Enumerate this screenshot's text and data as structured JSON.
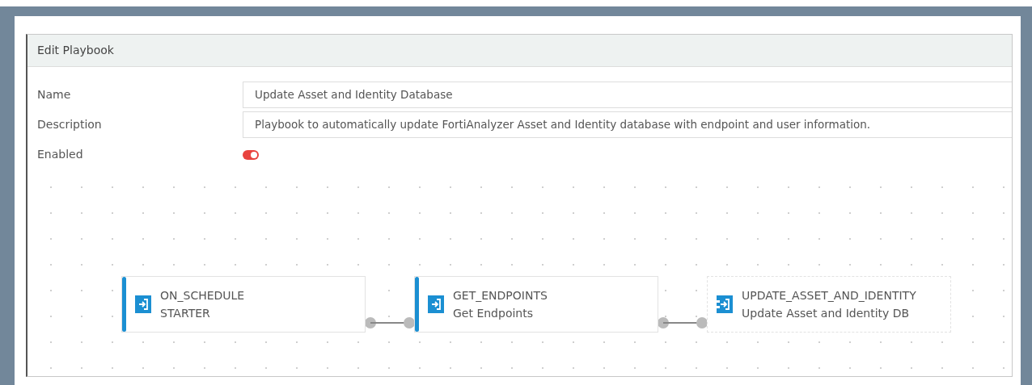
{
  "panel": {
    "title": "Edit Playbook"
  },
  "fields": [
    {
      "label": "Name",
      "value": "Update Asset and Identity Database"
    },
    {
      "label": "Description",
      "value": "Playbook to automatically update FortiAnalyzer Asset and Identity database with endpoint and user information."
    }
  ],
  "enabled": {
    "label": "Enabled",
    "on": true
  },
  "nodes": [
    {
      "kind": "trigger",
      "name": "ON_SCHEDULE",
      "subtitle": "STARTER"
    },
    {
      "kind": "local",
      "name": "GET_ENDPOINTS",
      "subtitle": "Get Endpoints"
    },
    {
      "kind": "connector",
      "name": "UPDATE_ASSET_AND_IDENTITY",
      "subtitle": "Update Asset and Identity DB"
    }
  ]
}
